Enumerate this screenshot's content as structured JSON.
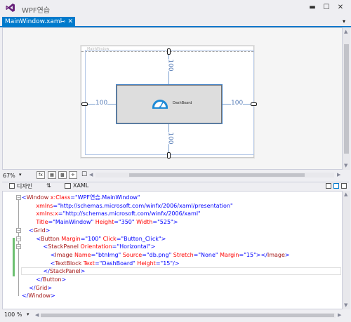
{
  "app": {
    "title": "WPF연습"
  },
  "titlebar_buttons": {
    "minimize": "▬",
    "maximize": "☐",
    "close": "✕",
    "menu": "▾"
  },
  "tab": {
    "label": "MainWindow.xaml",
    "pin": "⊸",
    "close": "✕",
    "dropdown": "▾"
  },
  "designer": {
    "window_caption": "MainWindow",
    "margins": {
      "top": "100",
      "bottom": "100",
      "left": "100",
      "right": "100"
    },
    "button_label": "DashBoard"
  },
  "designer_toolbar": {
    "zoom": "67%",
    "zoom_dropdown": "▾",
    "fx_label": "fx"
  },
  "split": {
    "design_tab": "디자인",
    "swap": "⇅",
    "xaml_tab": "XAML"
  },
  "editor": {
    "zoom": "100 %",
    "lines": [
      [
        [
          "tk-b",
          "<"
        ],
        [
          "tk-m",
          "Window "
        ],
        [
          "tk-a",
          "x:Class"
        ],
        [
          "tk-b",
          "=\""
        ],
        [
          "tk-v",
          "WPF연습.MainWindow"
        ],
        [
          "tk-b",
          "\""
        ]
      ],
      [
        [
          "tk-a",
          "        xmlns"
        ],
        [
          "tk-b",
          "=\""
        ],
        [
          "tk-v",
          "http://schemas.microsoft.com/winfx/2006/xaml/presentation"
        ],
        [
          "tk-b",
          "\""
        ]
      ],
      [
        [
          "tk-a",
          "        xmlns:x"
        ],
        [
          "tk-b",
          "=\""
        ],
        [
          "tk-v",
          "http://schemas.microsoft.com/winfx/2006/xaml"
        ],
        [
          "tk-b",
          "\""
        ]
      ],
      [
        [
          "tk-a",
          "        Title"
        ],
        [
          "tk-b",
          "=\""
        ],
        [
          "tk-v",
          "MainWindow"
        ],
        [
          "tk-b",
          "\" "
        ],
        [
          "tk-a",
          "Height"
        ],
        [
          "tk-b",
          "=\""
        ],
        [
          "tk-v",
          "350"
        ],
        [
          "tk-b",
          "\" "
        ],
        [
          "tk-a",
          "Width"
        ],
        [
          "tk-b",
          "=\""
        ],
        [
          "tk-v",
          "525"
        ],
        [
          "tk-b",
          "\">"
        ]
      ],
      [
        [
          "tk-b",
          "    <"
        ],
        [
          "tk-m",
          "Grid"
        ],
        [
          "tk-b",
          ">"
        ]
      ],
      [
        [
          "tk-b",
          "        <"
        ],
        [
          "tk-m",
          "Button "
        ],
        [
          "tk-a",
          "Margin"
        ],
        [
          "tk-b",
          "=\""
        ],
        [
          "tk-v",
          "100"
        ],
        [
          "tk-b",
          "\" "
        ],
        [
          "tk-a",
          "Click"
        ],
        [
          "tk-b",
          "=\""
        ],
        [
          "tk-v",
          "Button_Click"
        ],
        [
          "tk-b",
          "\">"
        ]
      ],
      [
        [
          "tk-b",
          "            <"
        ],
        [
          "tk-m",
          "StackPanel "
        ],
        [
          "tk-a",
          "Orientation"
        ],
        [
          "tk-b",
          "=\""
        ],
        [
          "tk-v",
          "Horizontal"
        ],
        [
          "tk-b",
          "\">"
        ]
      ],
      [
        [
          "tk-b",
          "                <"
        ],
        [
          "tk-m",
          "Image "
        ],
        [
          "tk-a",
          "Name"
        ],
        [
          "tk-b",
          "=\""
        ],
        [
          "tk-v",
          "btnImg"
        ],
        [
          "tk-b",
          "\" "
        ],
        [
          "tk-a",
          "Source"
        ],
        [
          "tk-b",
          "=\""
        ],
        [
          "tk-v",
          "db.png"
        ],
        [
          "tk-b",
          "\" "
        ],
        [
          "tk-a",
          "Stretch"
        ],
        [
          "tk-b",
          "=\""
        ],
        [
          "tk-v",
          "None"
        ],
        [
          "tk-b",
          "\" "
        ],
        [
          "tk-a",
          "Margin"
        ],
        [
          "tk-b",
          "=\""
        ],
        [
          "tk-v",
          "15"
        ],
        [
          "tk-b",
          "\"></"
        ],
        [
          "tk-m",
          "Image"
        ],
        [
          "tk-b",
          ">"
        ]
      ],
      [
        [
          "tk-b",
          "                <"
        ],
        [
          "tk-m",
          "TextBlock "
        ],
        [
          "tk-a",
          "Text"
        ],
        [
          "tk-b",
          "=\""
        ],
        [
          "tk-v",
          "DashBoard"
        ],
        [
          "tk-b",
          "\" "
        ],
        [
          "tk-a",
          "Height"
        ],
        [
          "tk-b",
          "=\""
        ],
        [
          "tk-v",
          "15"
        ],
        [
          "tk-b",
          "\"/>"
        ]
      ],
      [
        [
          "tk-b",
          "            </"
        ],
        [
          "tk-m",
          "StackPanel"
        ],
        [
          "tk-b",
          ">"
        ]
      ],
      [
        [
          "tk-b",
          "        </"
        ],
        [
          "tk-m",
          "Button"
        ],
        [
          "tk-b",
          ">"
        ]
      ],
      [
        [
          "tk-b",
          "    </"
        ],
        [
          "tk-m",
          "Grid"
        ],
        [
          "tk-b",
          ">"
        ]
      ],
      [
        [
          "tk-b",
          "</"
        ],
        [
          "tk-m",
          "Window"
        ],
        [
          "tk-b",
          ">"
        ]
      ]
    ]
  },
  "colors": {
    "accent": "#007acc",
    "change_bar": "#6cc070",
    "selection": "#4a86c8"
  }
}
